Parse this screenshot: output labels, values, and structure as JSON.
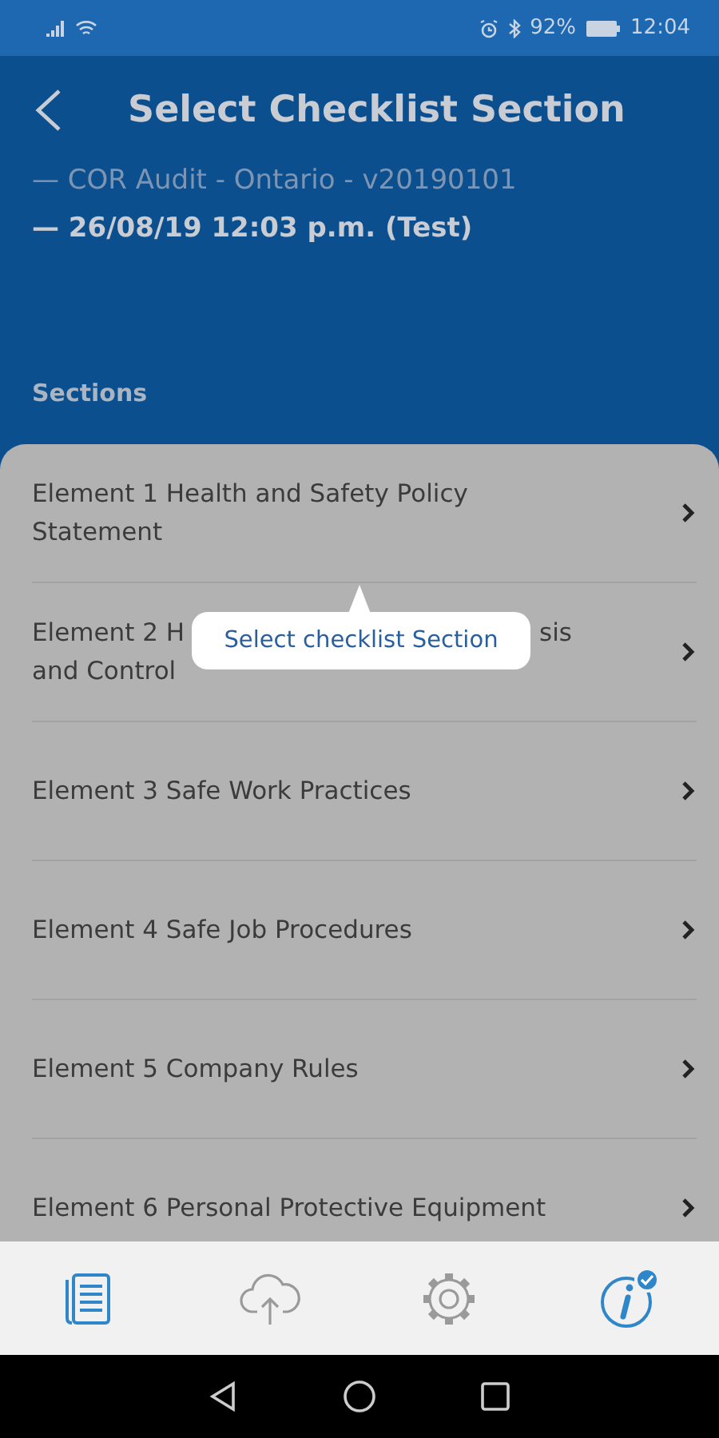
{
  "status_bar": {
    "battery": "92%",
    "time": "12:04"
  },
  "header": {
    "title": "Select Checklist Section",
    "audit": "— COR Audit - Ontario - v20190101",
    "session": "— 26/08/19 12:03 p.m. (Test)"
  },
  "sections_label": "Sections",
  "sections": [
    {
      "lines": [
        [
          "Element 1 Health and Safety Policy"
        ],
        [
          "Statement"
        ]
      ]
    },
    {
      "lines": [
        [
          "Element 2 H",
          "sis"
        ],
        [
          "and Control"
        ]
      ]
    },
    {
      "lines": [
        [
          "Element 3 Safe Work Practices"
        ]
      ]
    },
    {
      "lines": [
        [
          "Element 4 Safe Job Procedures"
        ]
      ]
    },
    {
      "lines": [
        [
          "Element 5 Company Rules"
        ]
      ]
    },
    {
      "lines": [
        [
          "Element 6 Personal Protective Equipment"
        ]
      ]
    }
  ],
  "tooltip": "Select checklist Section",
  "tabs": [
    {
      "kind": "list",
      "selected": true
    },
    {
      "kind": "upload",
      "selected": false
    },
    {
      "kind": "settings",
      "selected": false
    },
    {
      "kind": "info",
      "selected": true
    }
  ]
}
